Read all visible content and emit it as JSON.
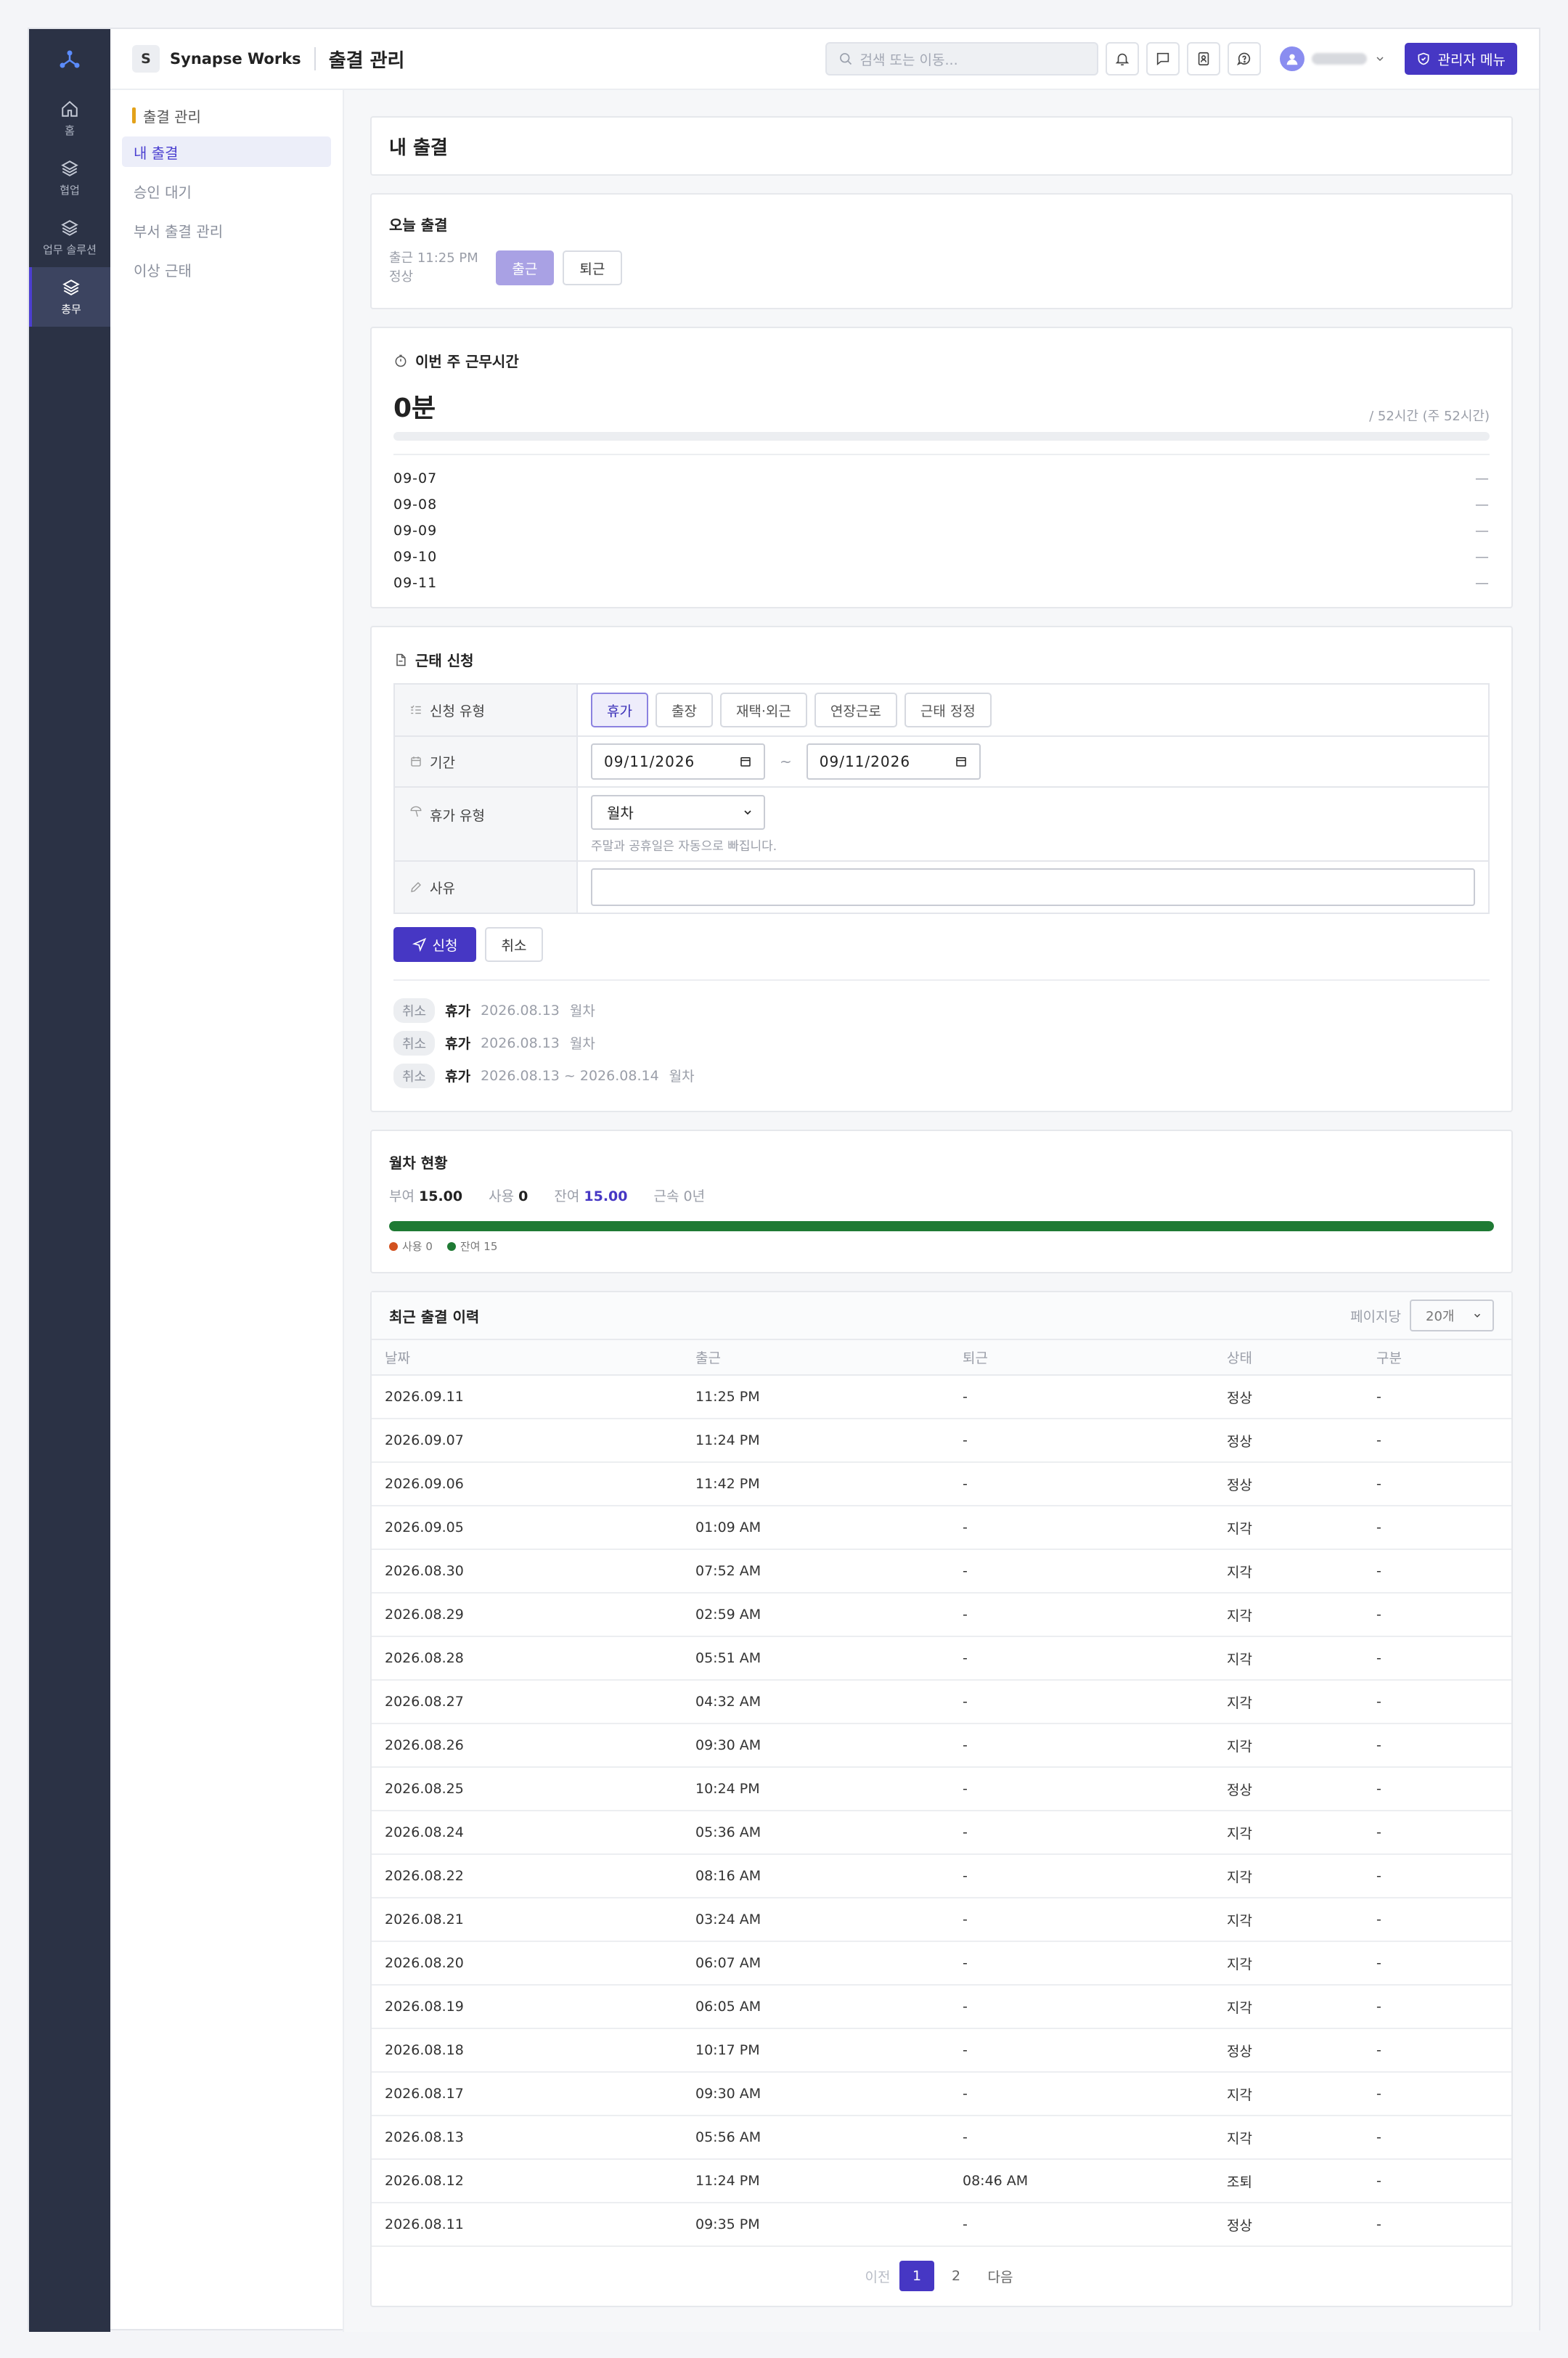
{
  "rail": {
    "items": [
      {
        "label": "홈"
      },
      {
        "label": "협업"
      },
      {
        "label": "업무 솔루션"
      },
      {
        "label": "총무"
      }
    ]
  },
  "topbar": {
    "org_initial": "S",
    "org_name": "Synapse Works",
    "page_title": "출결 관리",
    "search_placeholder": "검색 또는 이동...",
    "admin_label": "관리자 메뉴"
  },
  "subnav": {
    "section": "출결 관리",
    "items": [
      "내 출결",
      "승인 대기",
      "부서 출결 관리",
      "이상 근태"
    ]
  },
  "header": {
    "title": "내 출결"
  },
  "today": {
    "title": "오늘 출결",
    "checkin_text": "출근 11:25 PM",
    "status_text": "정상",
    "checkin_btn": "출근",
    "checkout_btn": "퇴근"
  },
  "weekly": {
    "title": "이번 주 근무시간",
    "total": "0분",
    "limit": "/ 52시간 (주 52시간)",
    "progress": 0,
    "days": [
      {
        "date": "09-07",
        "value": "—"
      },
      {
        "date": "09-08",
        "value": "—"
      },
      {
        "date": "09-09",
        "value": "—"
      },
      {
        "date": "09-10",
        "value": "—"
      },
      {
        "date": "09-11",
        "value": "—"
      }
    ]
  },
  "request": {
    "title": "근태 신청",
    "type_label": "신청 유형",
    "types": [
      "휴가",
      "출장",
      "재택·외근",
      "연장근로",
      "근태 정정"
    ],
    "selected_type": "휴가",
    "period_label": "기간",
    "start_date": "09/11/2026",
    "end_date": "09/11/2026",
    "period_sep": "~",
    "leave_type_label": "휴가 유형",
    "leave_type_value": "월차",
    "leave_hint": "주말과 공휴일은 자동으로 빠집니다.",
    "reason_label": "사유",
    "reason_value": "",
    "submit_label": "신청",
    "cancel_label": "취소",
    "history": [
      {
        "status": "취소",
        "type": "휴가",
        "date": "2026.08.13",
        "kind": "월차"
      },
      {
        "status": "취소",
        "type": "휴가",
        "date": "2026.08.13",
        "kind": "월차"
      },
      {
        "status": "취소",
        "type": "휴가",
        "date": "2026.08.13 ~ 2026.08.14",
        "kind": "월차"
      }
    ]
  },
  "leave": {
    "title": "월차 현황",
    "granted_label": "부여",
    "granted": "15.00",
    "used_label": "사용",
    "used": "0",
    "remain_label": "잔여",
    "remain": "15.00",
    "tenure": "근속 0년",
    "remain_ratio": 1,
    "legend_used": "사용 0",
    "legend_remain": "잔여 15",
    "colors": {
      "used": "#d2511f",
      "remain": "#1f7a34"
    }
  },
  "history": {
    "title": "최근 출결 이력",
    "per_page_label": "페이지당",
    "per_page_value": "20개",
    "columns": [
      "날짜",
      "출근",
      "퇴근",
      "상태",
      "구분"
    ],
    "rows": [
      [
        "2026.09.11",
        "11:25 PM",
        "-",
        "정상",
        "-"
      ],
      [
        "2026.09.07",
        "11:24 PM",
        "-",
        "정상",
        "-"
      ],
      [
        "2026.09.06",
        "11:42 PM",
        "-",
        "정상",
        "-"
      ],
      [
        "2026.09.05",
        "01:09 AM",
        "-",
        "지각",
        "-"
      ],
      [
        "2026.08.30",
        "07:52 AM",
        "-",
        "지각",
        "-"
      ],
      [
        "2026.08.29",
        "02:59 AM",
        "-",
        "지각",
        "-"
      ],
      [
        "2026.08.28",
        "05:51 AM",
        "-",
        "지각",
        "-"
      ],
      [
        "2026.08.27",
        "04:32 AM",
        "-",
        "지각",
        "-"
      ],
      [
        "2026.08.26",
        "09:30 AM",
        "-",
        "지각",
        "-"
      ],
      [
        "2026.08.25",
        "10:24 PM",
        "-",
        "정상",
        "-"
      ],
      [
        "2026.08.24",
        "05:36 AM",
        "-",
        "지각",
        "-"
      ],
      [
        "2026.08.22",
        "08:16 AM",
        "-",
        "지각",
        "-"
      ],
      [
        "2026.08.21",
        "03:24 AM",
        "-",
        "지각",
        "-"
      ],
      [
        "2026.08.20",
        "06:07 AM",
        "-",
        "지각",
        "-"
      ],
      [
        "2026.08.19",
        "06:05 AM",
        "-",
        "지각",
        "-"
      ],
      [
        "2026.08.18",
        "10:17 PM",
        "-",
        "정상",
        "-"
      ],
      [
        "2026.08.17",
        "09:30 AM",
        "-",
        "지각",
        "-"
      ],
      [
        "2026.08.13",
        "05:56 AM",
        "-",
        "지각",
        "-"
      ],
      [
        "2026.08.12",
        "11:24 PM",
        "08:46 AM",
        "조퇴",
        "-"
      ],
      [
        "2026.08.11",
        "09:35 PM",
        "-",
        "정상",
        "-"
      ]
    ],
    "pagination": {
      "prev": "이전",
      "pages": [
        "1",
        "2"
      ],
      "current": "1",
      "next": "다음"
    }
  }
}
